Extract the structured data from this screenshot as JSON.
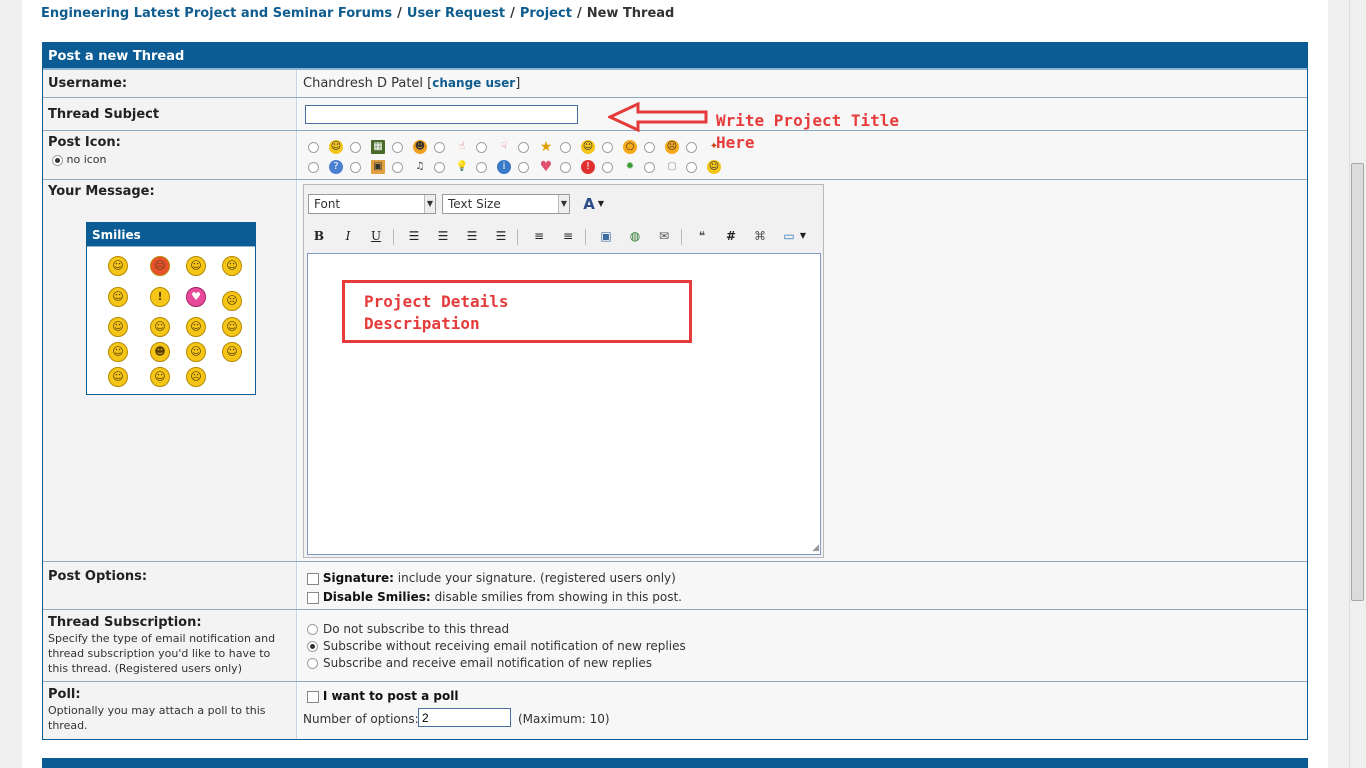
{
  "breadcrumb": {
    "items": [
      "Engineering Latest Project and Seminar Forums",
      "User Request",
      "Project"
    ],
    "separator": "/",
    "current": "New Thread"
  },
  "form": {
    "header": "Post a new Thread",
    "username_label": "Username:",
    "username_value": "Chandresh D Patel",
    "change_user_label": "change user",
    "subject_label": "Thread Subject",
    "subject_value": "",
    "post_icon_label": "Post Icon:",
    "no_icon_label": "no icon",
    "message_label": "Your Message:",
    "editor": {
      "font_label": "Font",
      "size_label": "Text Size"
    },
    "smilies_title": "Smilies",
    "post_options_label": "Post Options:",
    "signature_bold": "Signature:",
    "signature_text": "include your signature. (registered users only)",
    "disable_smilies_bold": "Disable Smilies:",
    "disable_smilies_text": "disable smilies from showing in this post.",
    "subscription_label": "Thread Subscription:",
    "subscription_desc": "Specify the type of email notification and thread subscription you'd like to have to this thread. (Registered users only)",
    "subscription_options": [
      "Do not subscribe to this thread",
      "Subscribe without receiving email notification of new replies",
      "Subscribe and receive email notification of new replies"
    ],
    "poll_label": "Poll:",
    "poll_desc": "Optionally you may attach a poll to this thread.",
    "poll_check_label": "I want to post a poll",
    "num_options_label": "Number of options:",
    "num_options_value": "2",
    "num_options_max": "(Maximum: 10)"
  },
  "annotations": {
    "arrow_text_line1": "Write Project Title",
    "arrow_text_line2": "Here",
    "box_text_line1": "Project Details",
    "box_text_line2": "Descripation",
    "color": "#e63b3b"
  },
  "colors": {
    "header_blue": "#0b5c94",
    "link_blue": "#0f5c8e"
  }
}
